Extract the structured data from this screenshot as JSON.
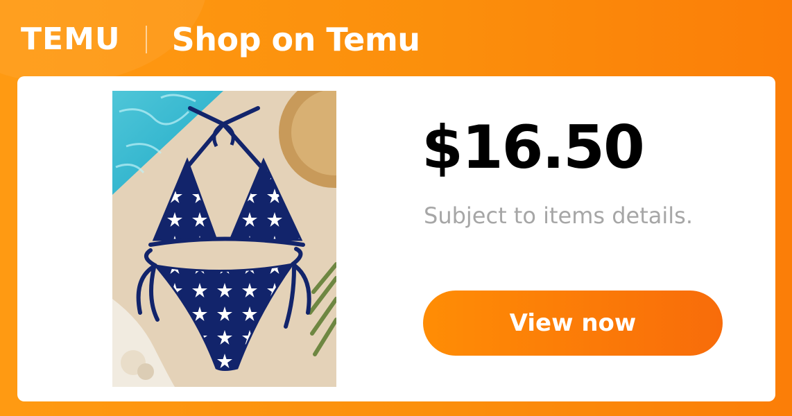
{
  "header": {
    "logo_text": "TEMU",
    "title": "Shop on Temu"
  },
  "product": {
    "image_icon": "bikini-product-photo",
    "price": "$16.50",
    "note": "Subject to items details."
  },
  "cta": {
    "label": "View now"
  },
  "colors": {
    "brand_orange": "#fb8f0c",
    "button_orange": "#f86c0a",
    "price_text": "#000000",
    "note_text": "#a6a6a6"
  }
}
